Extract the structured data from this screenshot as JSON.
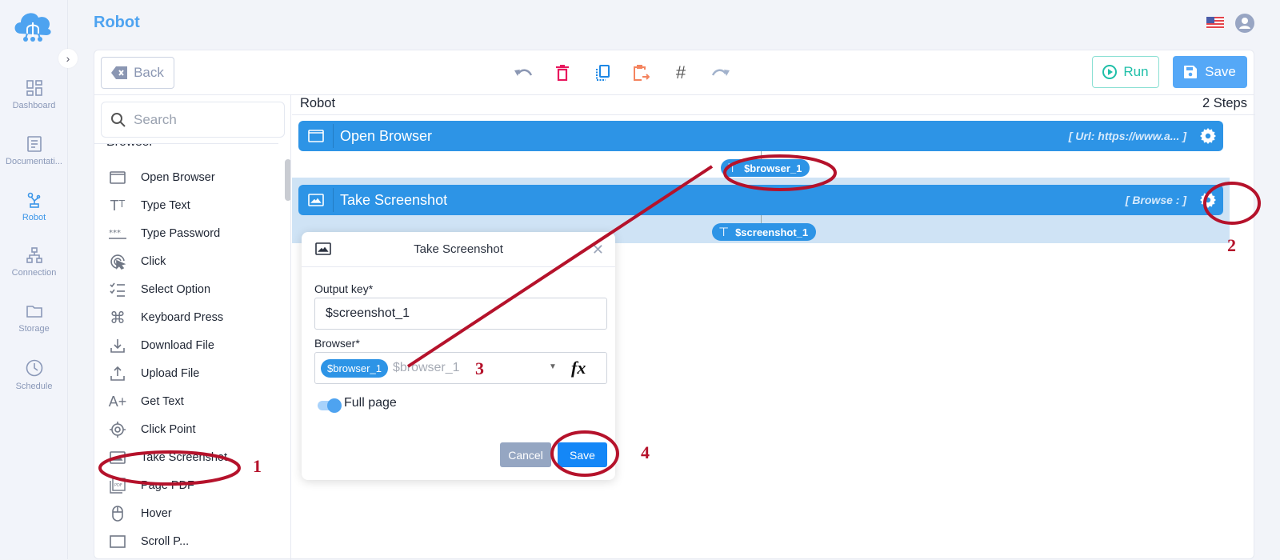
{
  "app": {
    "page_title": "Robot",
    "language_flag": "us-flag-icon",
    "user": "user-avatar-icon"
  },
  "sidebar": {
    "items": [
      {
        "label": "Dashboard",
        "icon": "dashboard-icon",
        "active": false
      },
      {
        "label": "Documentati...",
        "icon": "document-icon",
        "active": false
      },
      {
        "label": "Robot",
        "icon": "robot-icon",
        "active": true
      },
      {
        "label": "Connection",
        "icon": "connection-icon",
        "active": false
      },
      {
        "label": "Storage",
        "icon": "folder-icon",
        "active": false
      },
      {
        "label": "Schedule",
        "icon": "clock-icon",
        "active": false
      }
    ]
  },
  "toolbar": {
    "back_label": "Back",
    "run_label": "Run",
    "save_label": "Save",
    "tools": [
      "undo-icon",
      "delete-icon",
      "duplicate-icon",
      "paste-icon",
      "hash-icon",
      "redo-icon"
    ],
    "colors": {
      "delete": "#e8175d",
      "duplicate": "#1e88e5",
      "paste": "#f4845f",
      "run": "#1fbfa8",
      "save": "#55a8f7"
    }
  },
  "palette": {
    "search_placeholder": "Search",
    "group": "Browser",
    "items": [
      {
        "label": "Open Browser",
        "icon": "window-icon"
      },
      {
        "label": "Type Text",
        "icon": "text-size-icon"
      },
      {
        "label": "Type Password",
        "icon": "password-icon"
      },
      {
        "label": "Click",
        "icon": "click-icon"
      },
      {
        "label": "Select Option",
        "icon": "checklist-icon"
      },
      {
        "label": "Keyboard Press",
        "icon": "command-key-icon"
      },
      {
        "label": "Download File",
        "icon": "download-icon"
      },
      {
        "label": "Upload File",
        "icon": "upload-icon"
      },
      {
        "label": "Get Text",
        "icon": "text-plus-icon"
      },
      {
        "label": "Click Point",
        "icon": "target-icon"
      },
      {
        "label": "Take Screenshot",
        "icon": "image-icon"
      },
      {
        "label": "Page PDF",
        "icon": "pdf-icon"
      },
      {
        "label": "Hover",
        "icon": "mouse-icon"
      },
      {
        "label": "Scroll P...",
        "icon": "scroll-icon"
      }
    ]
  },
  "canvas": {
    "title": "Robot",
    "steps_count": "2 Steps",
    "steps": [
      {
        "name": "Open Browser",
        "param": "[ Url: https://www.a...  ]",
        "output": "$browser_1"
      },
      {
        "name": "Take Screenshot",
        "param": "[ Browse : ]",
        "output": "$screenshot_1"
      }
    ]
  },
  "modal": {
    "title": "Take Screenshot",
    "output_key_label": "Output key*",
    "output_key_value": "$screenshot_1",
    "browser_label": "Browser*",
    "browser_chip": "$browser_1",
    "browser_placeholder": "$browser_1",
    "fx_label": "fx",
    "full_page_label": "Full page",
    "full_page_on": true,
    "cancel_label": "Cancel",
    "save_label": "Save"
  },
  "annotations": {
    "numbers": [
      "1",
      "2",
      "3",
      "4"
    ],
    "color": "#b5122b"
  }
}
